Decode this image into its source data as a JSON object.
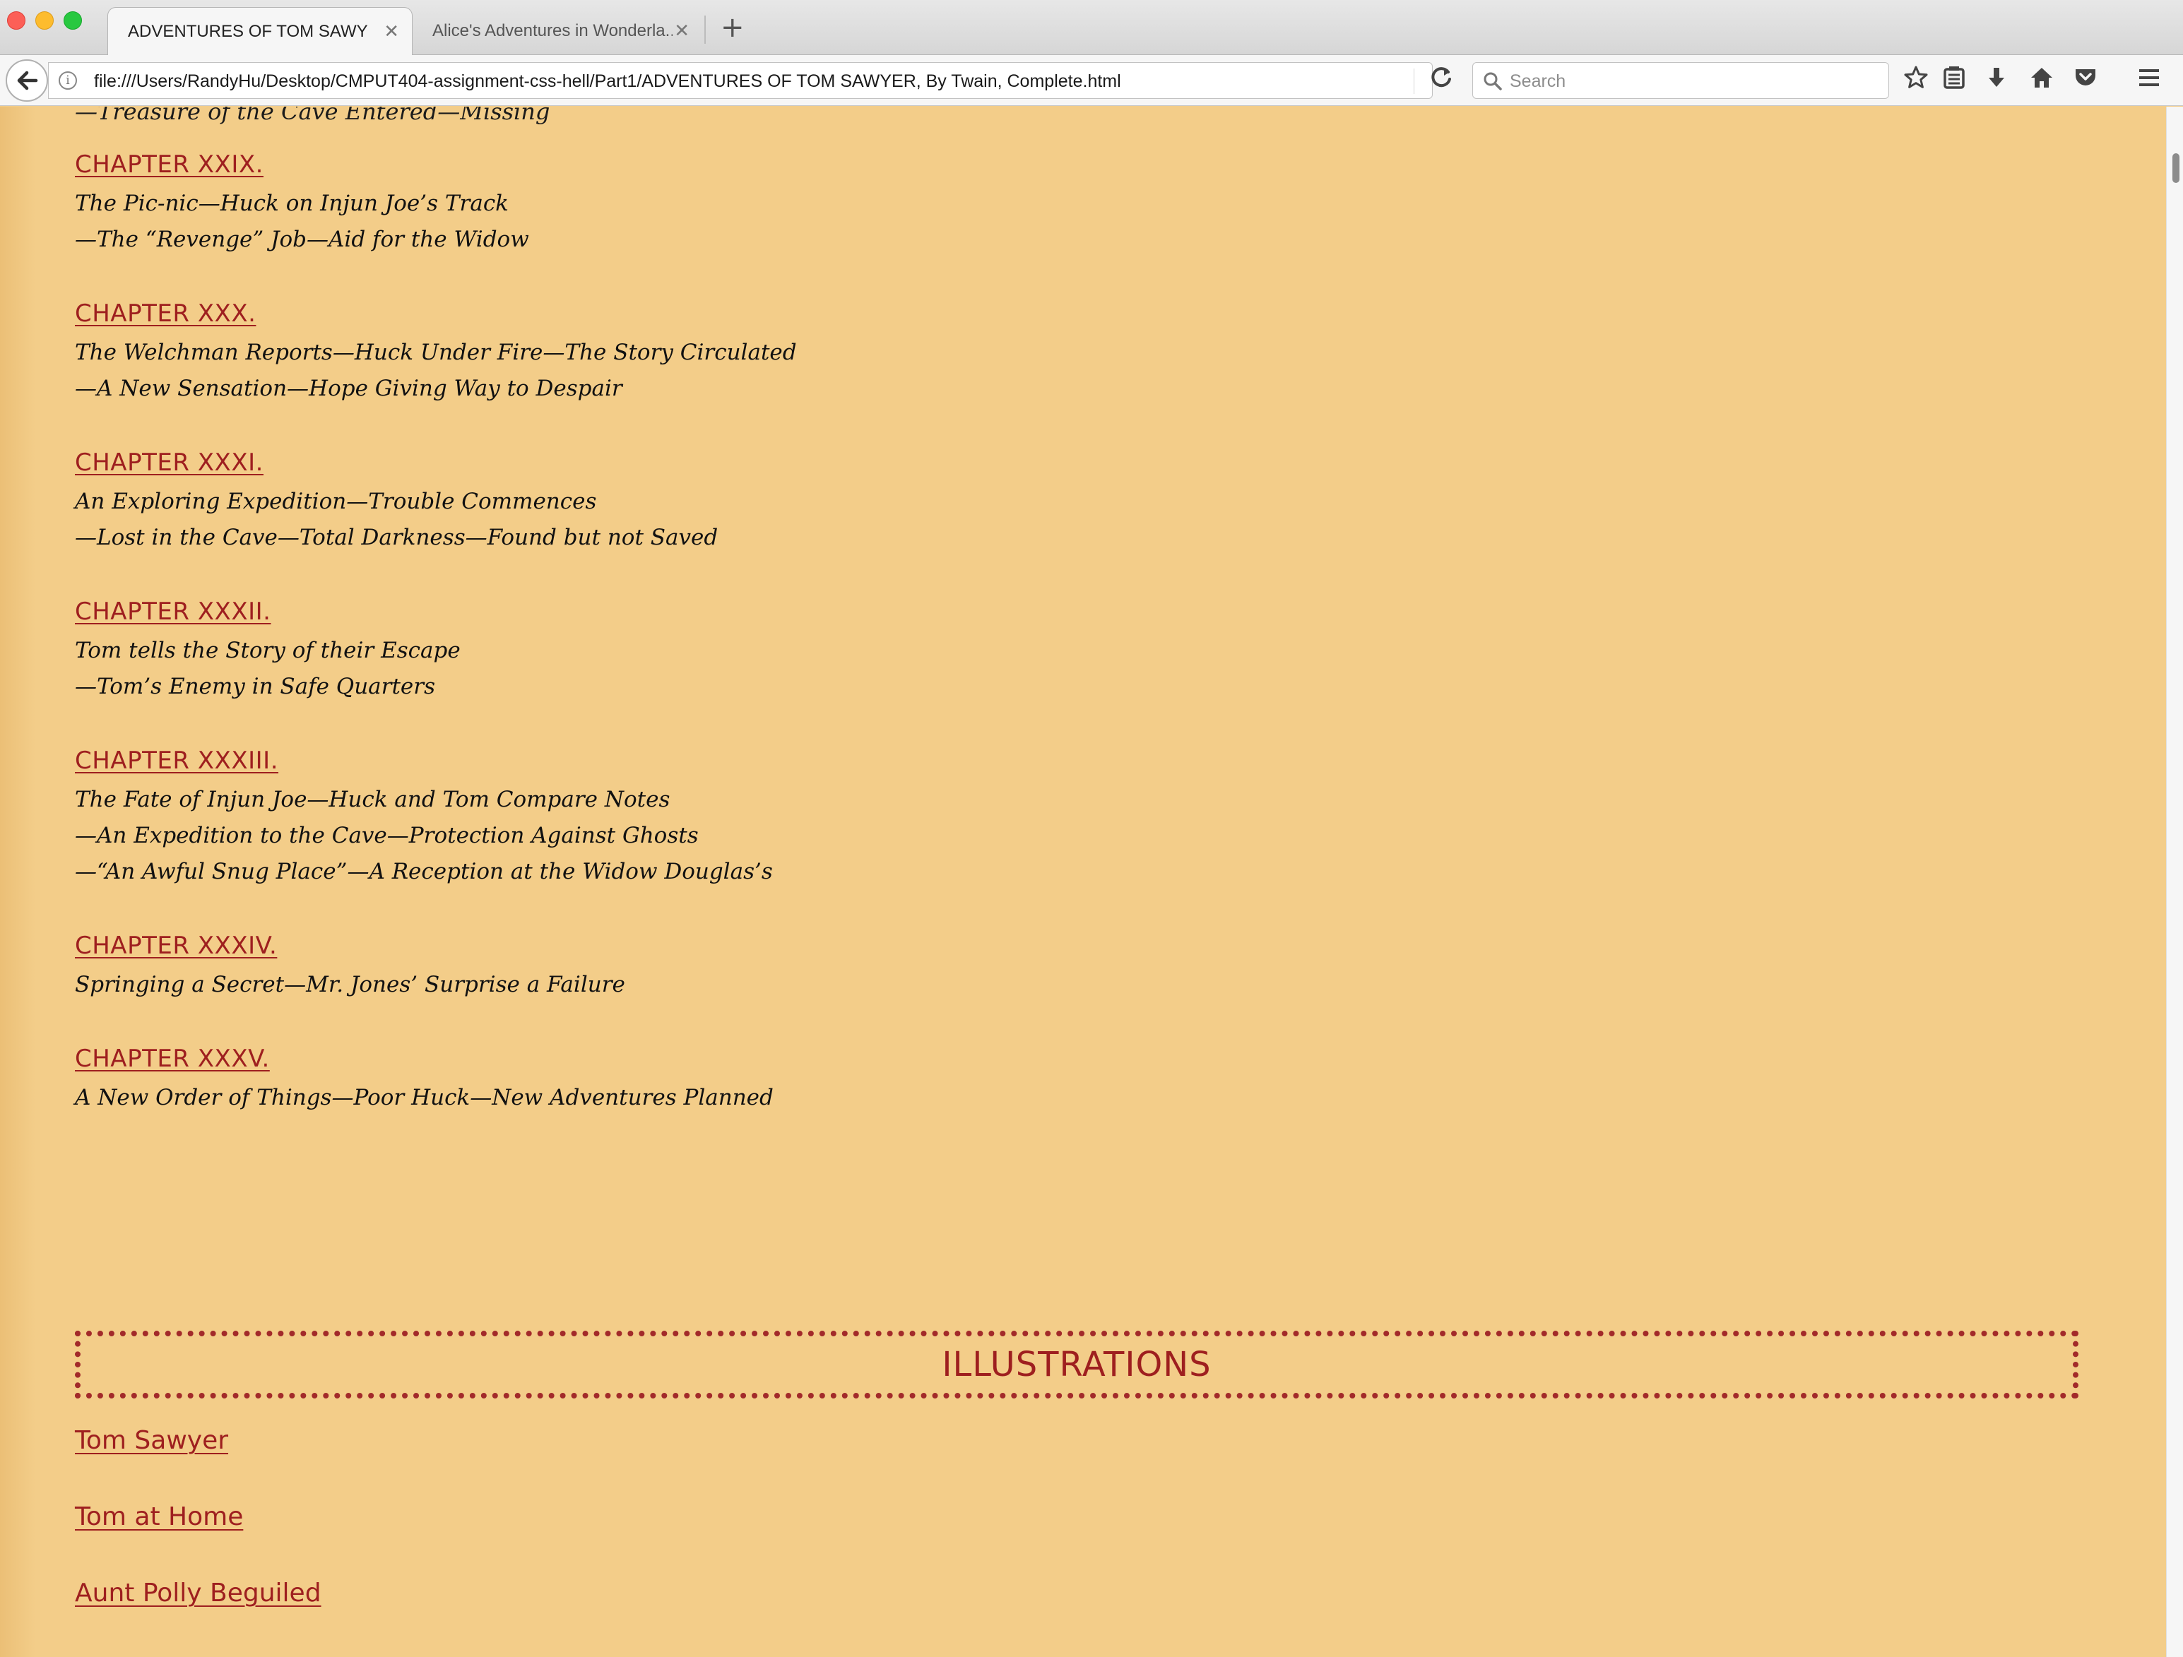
{
  "browser": {
    "tabs": [
      {
        "title": "ADVENTURES OF TOM SAWYE...",
        "active": true
      },
      {
        "title": "Alice's Adventures in Wonderla...",
        "active": false
      }
    ],
    "url": "file:///Users/RandyHu/Desktop/CMPUT404-assignment-css-hell/Part1/ADVENTURES OF TOM SAWYER, By Twain, Complete.html",
    "search_placeholder": "Search"
  },
  "page": {
    "cut_line": "—Treasure of the Cave Entered—Missing",
    "chapters": [
      {
        "title": "CHAPTER XXIX.",
        "lines": [
          "The Pic-nic—Huck on Injun Joe’s Track",
          "—The “Revenge” Job—Aid for the Widow"
        ]
      },
      {
        "title": "CHAPTER XXX.",
        "lines": [
          "The Welchman Reports—Huck Under Fire—The Story Circulated",
          "—A New Sensation—Hope Giving Way to Despair"
        ]
      },
      {
        "title": "CHAPTER XXXI.",
        "lines": [
          "An Exploring Expedition—Trouble Commences",
          "—Lost in the Cave—Total Darkness—Found but not Saved"
        ]
      },
      {
        "title": "CHAPTER XXXII.",
        "lines": [
          "Tom tells the Story of their Escape",
          "—Tom’s Enemy in Safe Quarters"
        ]
      },
      {
        "title": "CHAPTER XXXIII.",
        "lines": [
          "The Fate of Injun Joe—Huck and Tom Compare Notes",
          "—An Expedition to the Cave—Protection Against Ghosts",
          "—“An Awful Snug Place”—A Reception at the Widow Douglas’s"
        ]
      },
      {
        "title": "CHAPTER XXXIV.",
        "lines": [
          "Springing a Secret—Mr. Jones’ Surprise a Failure"
        ]
      },
      {
        "title": "CHAPTER XXXV.",
        "lines": [
          "A New Order of Things—Poor Huck—New Adventures Planned"
        ]
      }
    ],
    "illustrations_heading": "ILLUSTRATIONS",
    "illustrations": [
      "Tom Sawyer",
      "Tom at Home",
      "Aunt Polly Beguiled"
    ]
  }
}
